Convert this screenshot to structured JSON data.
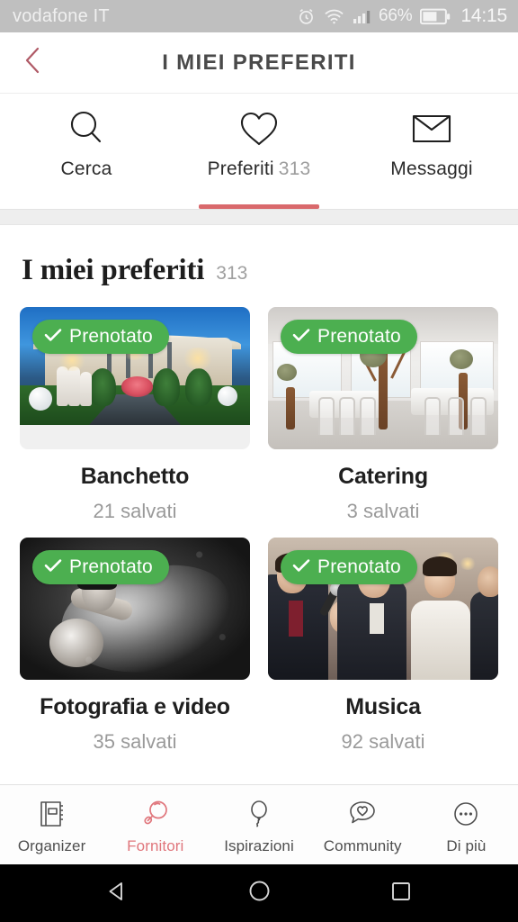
{
  "status_bar": {
    "carrier": "vodafone IT",
    "battery_percent": "66%",
    "time": "14:15",
    "icons": [
      "alarm-icon",
      "wifi-icon",
      "signal-icon",
      "battery-icon"
    ]
  },
  "header": {
    "back_icon": "chevron-left-icon",
    "title": "I MIEI PREFERITI",
    "accent_color": "#b05a66"
  },
  "top_tabs": {
    "active_index": 1,
    "underline_color": "#d9696c",
    "items": [
      {
        "label": "Cerca",
        "count": "",
        "icon": "search-icon"
      },
      {
        "label": "Preferiti",
        "count": "313",
        "icon": "heart-icon"
      },
      {
        "label": "Messaggi",
        "count": "",
        "icon": "envelope-icon"
      }
    ]
  },
  "section": {
    "title": "I miei preferiti",
    "count": "313"
  },
  "badge": {
    "label": "Prenotato",
    "icon": "check-icon",
    "color": "#4caf50"
  },
  "cards": [
    {
      "title": "Banchetto",
      "saved": "21 salvati",
      "badge": "Prenotato",
      "scene": "night-venue-photo"
    },
    {
      "title": "Catering",
      "saved": "3 salvati",
      "badge": "Prenotato",
      "scene": "banquet-hall-photo"
    },
    {
      "title": "Fotografia e video",
      "saved": "35 salvati",
      "badge": "Prenotato",
      "scene": "bride-portrait-photo"
    },
    {
      "title": "Musica",
      "saved": "92 salvati",
      "badge": "Prenotato",
      "scene": "wedding-couple-photo"
    }
  ],
  "bottom_nav": {
    "active_index": 1,
    "active_color": "#e0767c",
    "items": [
      {
        "label": "Organizer",
        "icon": "notebook-icon"
      },
      {
        "label": "Fornitori",
        "icon": "search-icon"
      },
      {
        "label": "Ispirazioni",
        "icon": "balloon-icon"
      },
      {
        "label": "Community",
        "icon": "chat-heart-icon"
      },
      {
        "label": "Di più",
        "icon": "ellipsis-circle-icon"
      }
    ]
  },
  "android_nav": {
    "items": [
      {
        "name": "back-button",
        "icon": "triangle-left-icon"
      },
      {
        "name": "home-button",
        "icon": "circle-icon"
      },
      {
        "name": "recents-button",
        "icon": "square-icon"
      }
    ]
  }
}
